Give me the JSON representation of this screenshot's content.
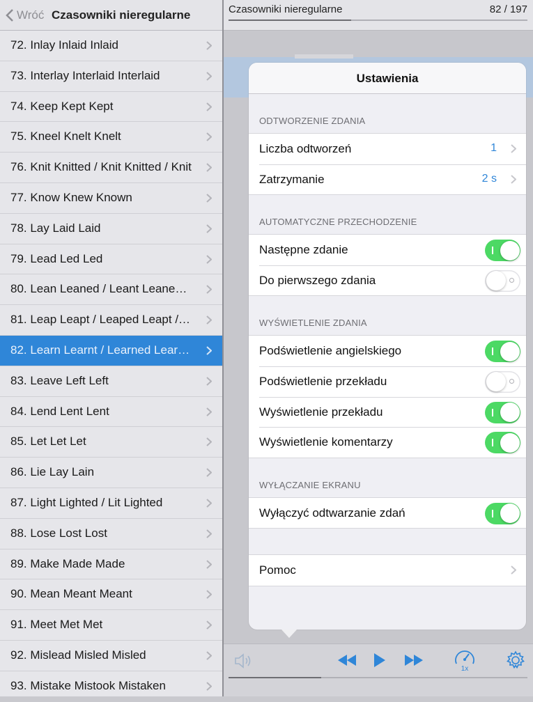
{
  "left_panel": {
    "back_label": "Wróć",
    "title": "Czasowniki nieregularne",
    "selected_index": 10,
    "items": [
      "72. Inlay Inlaid Inlaid",
      "73. Interlay Interlaid Interlaid",
      "74. Keep Kept Kept",
      "75. Kneel Knelt Knelt",
      "76. Knit Knitted / Knit Knitted / Knit",
      "77. Know Knew Known",
      "78. Lay Laid Laid",
      "79. Lead Led Led",
      "80. Lean Leaned / Leant Leaned…",
      "81. Leap Leapt / Leaped Leapt /…",
      "82. Learn Learnt / Learned Learn…",
      "83. Leave Left Left",
      "84. Lend Lent Lent",
      "85. Let Let Let",
      "86. Lie Lay Lain",
      "87. Light Lighted / Lit Lighted",
      "88. Lose Lost Lost",
      "89. Make Made Made",
      "90. Mean Meant Meant",
      "91. Meet Met Met",
      "92. Mislead Misled Misled",
      "93. Mistake Mistook Mistaken"
    ]
  },
  "right_panel": {
    "title": "Czasowniki nieregularne",
    "counter": "82 / 197",
    "top_progress": 0.41,
    "bottom_progress": 0.31
  },
  "settings": {
    "title": "Ustawienia",
    "sections": [
      {
        "header": "ODTWORZENIE ZDANIA",
        "cells": [
          {
            "label": "Liczba odtworzeń",
            "type": "value",
            "value": "1"
          },
          {
            "label": "Zatrzymanie",
            "type": "value",
            "value": "2 s"
          }
        ]
      },
      {
        "header": "AUTOMATYCZNE PRZECHODZENIE",
        "cells": [
          {
            "label": "Następne zdanie",
            "type": "toggle",
            "on": true
          },
          {
            "label": "Do pierwszego zdania",
            "type": "toggle",
            "on": false
          }
        ]
      },
      {
        "header": "WYŚWIETLENIE ZDANIA",
        "cells": [
          {
            "label": "Podświetlenie angielskiego",
            "type": "toggle",
            "on": true
          },
          {
            "label": "Podświetlenie przekładu",
            "type": "toggle",
            "on": false
          },
          {
            "label": "Wyświetlenie przekładu",
            "type": "toggle",
            "on": true
          },
          {
            "label": "Wyświetlenie komentarzy",
            "type": "toggle",
            "on": true
          }
        ]
      },
      {
        "header": "WYŁĄCZANIE EKRANU",
        "cells": [
          {
            "label": "Wyłączyć odtwarzanie zdań",
            "type": "toggle",
            "on": true
          }
        ]
      }
    ],
    "help": {
      "label": "Pomoc"
    }
  },
  "playback": {
    "speed_label": "1x"
  },
  "icons": {
    "back": "chevron-left-icon",
    "row_chevron": "chevron-right-icon",
    "speaker": "speaker-icon",
    "rewind": "rewind-icon",
    "play": "play-icon",
    "fast_forward": "fast-forward-icon",
    "speed": "speedometer-icon",
    "settings": "gear-icon"
  },
  "colors": {
    "accent": "#2f86d8",
    "toggle_on": "#4cd964",
    "selected_row": "#2f86d8"
  }
}
